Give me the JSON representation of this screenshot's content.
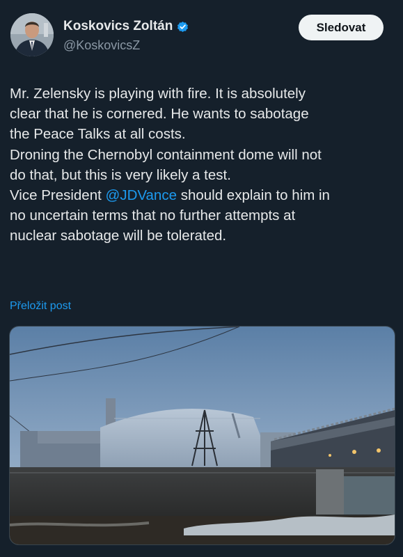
{
  "author": {
    "name": "Koskovics Zoltán",
    "handle": "@KoskovicsZ",
    "verified_icon": "verified-badge-icon",
    "avatar_icon": "profile-photo"
  },
  "follow_button": {
    "label": "Sledovat"
  },
  "tweet": {
    "lines": [
      {
        "text": "Mr. Zelensky is playing with fire. It is absolutely"
      },
      {
        "text": "clear that he is cornered. He wants to sabotage"
      },
      {
        "text": "the Peace Talks at all costs."
      },
      {
        "text": "Droning the Chernobyl containment dome will not"
      },
      {
        "text": "do that, but this is very likely a test."
      },
      {
        "pre": "Vice President ",
        "mention": "@JDVance",
        "post": " should explain to him in"
      },
      {
        "text": "no uncertain terms that no further attempts at"
      },
      {
        "text": "nuclear sabotage will be tolerated."
      }
    ]
  },
  "translate_link": {
    "label": "Přeložit post"
  },
  "colors": {
    "background": "#15202b",
    "text": "#e7e9ea",
    "secondary": "#8b98a5",
    "accent": "#1d9bf0",
    "verified": "#1d9bf0"
  }
}
